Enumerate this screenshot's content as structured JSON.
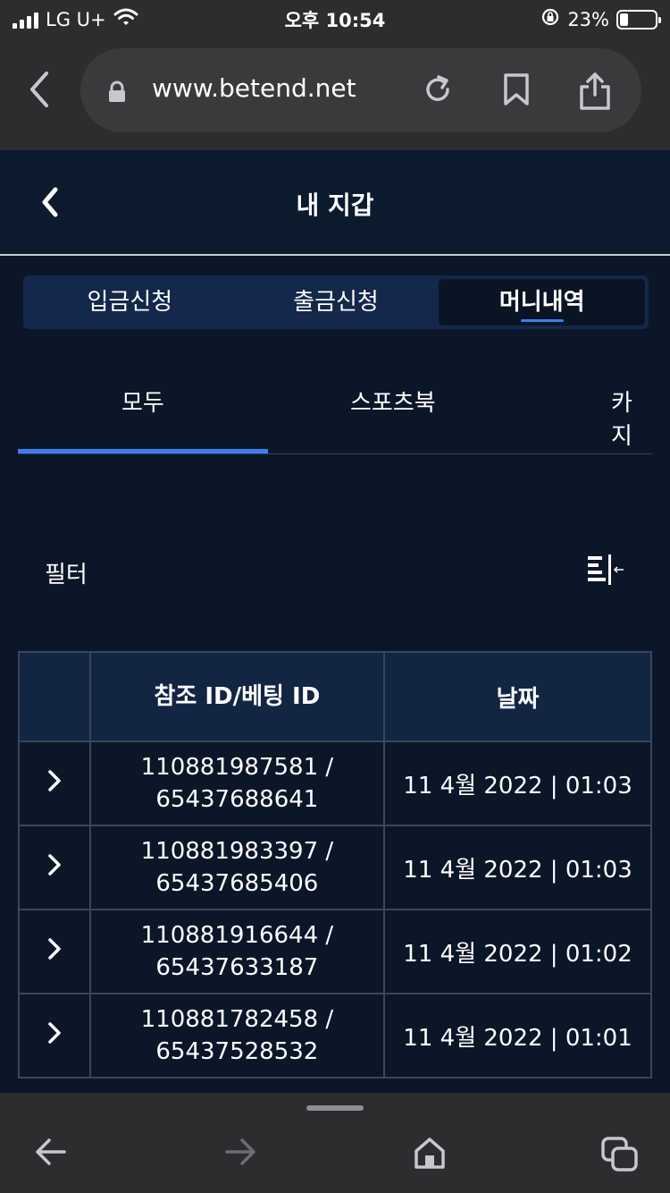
{
  "status_bar": {
    "carrier": "LG U+",
    "time": "오후 10:54",
    "battery": "23%"
  },
  "browser": {
    "url": "www.betend.net"
  },
  "header": {
    "title": "내 지갑"
  },
  "segments": [
    {
      "label": "입금신청"
    },
    {
      "label": "출금신청"
    },
    {
      "label": "머니내역",
      "active": true
    }
  ],
  "categories": [
    {
      "label": "모두",
      "active": true
    },
    {
      "label": "스포츠북"
    },
    {
      "label": "카지"
    }
  ],
  "filter": {
    "label": "필터"
  },
  "table": {
    "headers": [
      "",
      "참조 ID/베팅 ID",
      "날짜"
    ],
    "rows": [
      {
        "ref_line1": "110881987581 /",
        "ref_line2": "65437688641",
        "date": "11 4월 2022 | 01:03"
      },
      {
        "ref_line1": "110881983397 /",
        "ref_line2": "65437685406",
        "date": "11 4월 2022 | 01:03"
      },
      {
        "ref_line1": "110881916644 /",
        "ref_line2": "65437633187",
        "date": "11 4월 2022 | 01:02"
      },
      {
        "ref_line1": "110881782458 /",
        "ref_line2": "65437528532",
        "date": "11 4월 2022 | 01:01"
      }
    ]
  },
  "colors": {
    "background": "#0b1628",
    "accent": "#3c7cf0",
    "browser_chrome": "#2d2d2f"
  }
}
